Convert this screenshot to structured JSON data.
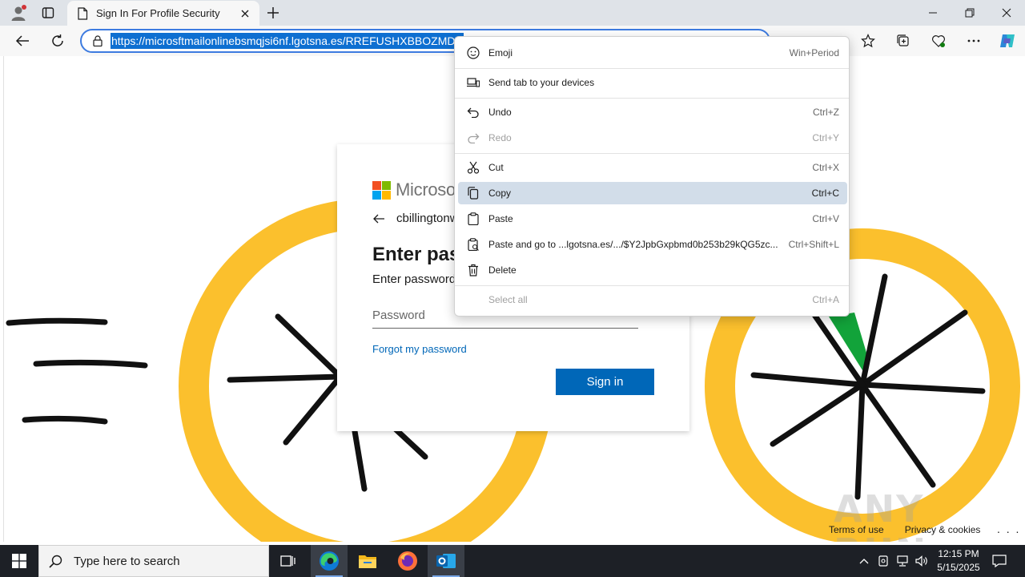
{
  "browser": {
    "tab_title": "Sign In For Profile Security",
    "url_visible": "https://microsftmailonlinebsmqjsi6nf.lgotsna.es/RREFUSHXBBOZMDV"
  },
  "signin": {
    "brand": "Microsoft",
    "identity": "cbillingtonw",
    "title": "Enter pass",
    "subtitle": "Enter password",
    "password_placeholder": "Password",
    "forgot_link": "Forgot my password",
    "signin_button": "Sign in"
  },
  "footer": {
    "terms": "Terms of use",
    "privacy": "Privacy & cookies",
    "more": ". . ."
  },
  "watermark": "ANY RUN",
  "context_menu": {
    "items": [
      {
        "label": "Emoji",
        "shortcut": "Win+Period",
        "icon": "emoji-icon",
        "disabled": false
      },
      {
        "label": "Send tab to your devices",
        "shortcut": "",
        "icon": "devices-icon",
        "disabled": false
      },
      {
        "label": "Undo",
        "shortcut": "Ctrl+Z",
        "icon": "undo-icon",
        "disabled": false
      },
      {
        "label": "Redo",
        "shortcut": "Ctrl+Y",
        "icon": "redo-icon",
        "disabled": true
      },
      {
        "label": "Cut",
        "shortcut": "Ctrl+X",
        "icon": "scissors-icon",
        "disabled": false
      },
      {
        "label": "Copy",
        "shortcut": "Ctrl+C",
        "icon": "copy-icon",
        "disabled": false,
        "highlighted": true
      },
      {
        "label": "Paste",
        "shortcut": "Ctrl+V",
        "icon": "paste-icon",
        "disabled": false
      },
      {
        "label": "Paste and go to ...lgotsna.es/.../$Y2JpbGxpbmd0b253b29kQG5zc...",
        "shortcut": "Ctrl+Shift+L",
        "icon": "paste-go-icon",
        "disabled": false
      },
      {
        "label": "Delete",
        "shortcut": "",
        "icon": "trash-icon",
        "disabled": false
      },
      {
        "label": "Select all",
        "shortcut": "Ctrl+A",
        "icon": "",
        "disabled": true
      }
    ]
  },
  "taskbar": {
    "search_placeholder": "Type here to search",
    "time": "12:15 PM",
    "date": "5/15/2025"
  },
  "colors": {
    "accent_blue": "#0067b8",
    "highlight": "#d2dde9",
    "wheel_yellow": "#fbc02d",
    "taskbar": "#1d2026"
  }
}
